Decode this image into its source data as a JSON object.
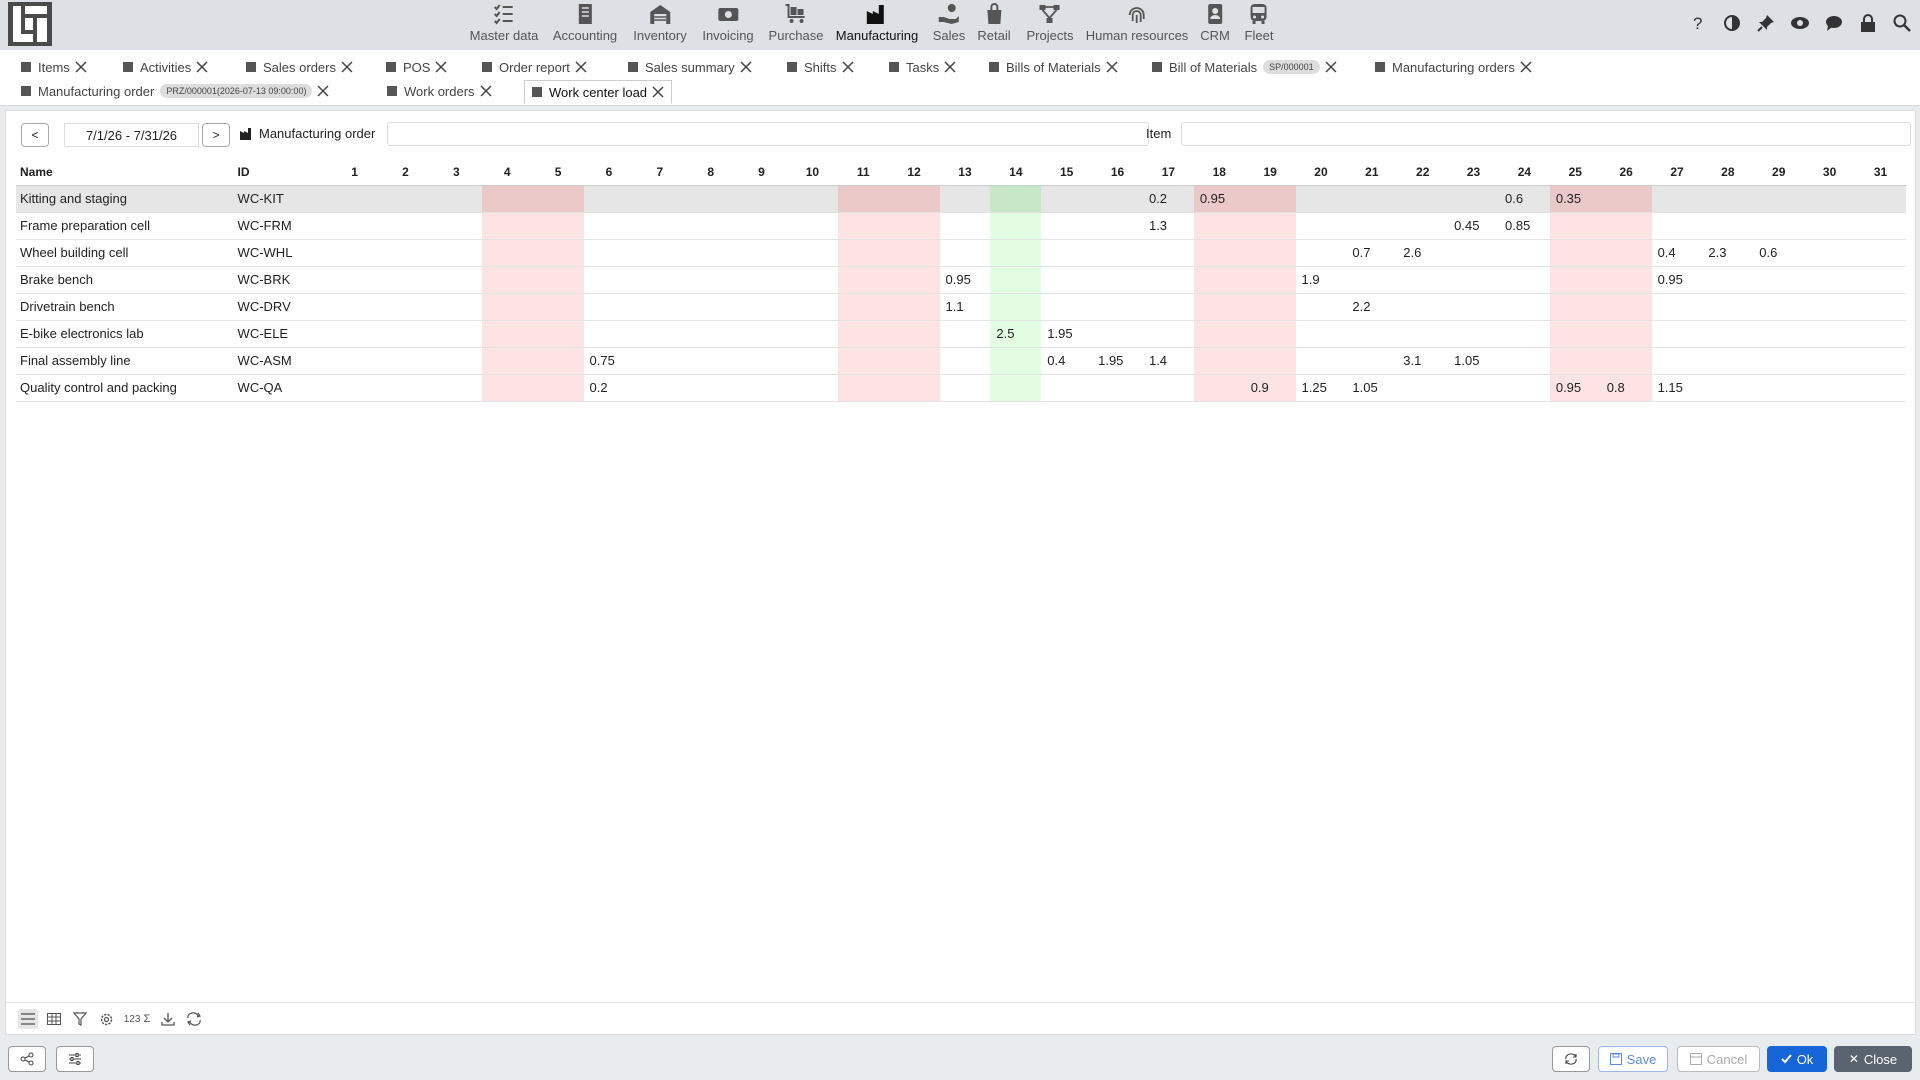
{
  "nav": {
    "items": [
      {
        "label": "Master data",
        "icon": "checklist-icon"
      },
      {
        "label": "Accounting",
        "icon": "ledger-icon"
      },
      {
        "label": "Inventory",
        "icon": "warehouse-icon"
      },
      {
        "label": "Invoicing",
        "icon": "cash-icon"
      },
      {
        "label": "Purchase",
        "icon": "cart-icon"
      },
      {
        "label": "Manufacturing",
        "icon": "factory-icon"
      },
      {
        "label": "Sales",
        "icon": "hand-coin-icon"
      },
      {
        "label": "Retail",
        "icon": "bag-icon"
      },
      {
        "label": "Projects",
        "icon": "hierarchy-icon"
      },
      {
        "label": "Human resources",
        "icon": "fingerprint-icon"
      },
      {
        "label": "CRM",
        "icon": "contact-icon"
      },
      {
        "label": "Fleet",
        "icon": "bus-icon"
      }
    ],
    "active": "Manufacturing"
  },
  "tabs": {
    "row1": [
      {
        "label": "Items"
      },
      {
        "label": "Activities"
      },
      {
        "label": "Sales orders"
      },
      {
        "label": "POS"
      },
      {
        "label": "Order report"
      },
      {
        "label": "Sales summary"
      },
      {
        "label": "Shifts"
      },
      {
        "label": "Tasks"
      },
      {
        "label": "Bills of Materials"
      },
      {
        "label": "Bill of Materials",
        "badge": "SP/000001"
      },
      {
        "label": "Manufacturing orders"
      }
    ],
    "row2": [
      {
        "label": "Manufacturing order",
        "badge": "PRZ/000001(2026-07-13 09:00:00)"
      },
      {
        "label": "Work orders"
      },
      {
        "label": "Work center load"
      }
    ]
  },
  "filters": {
    "prev": "<",
    "next": ">",
    "date_range": "7/1/26 - 7/31/26",
    "mo_label": "Manufacturing order",
    "item_label": "Item"
  },
  "grid": {
    "headers": {
      "name": "Name",
      "id": "ID"
    },
    "days": [
      "1",
      "2",
      "3",
      "4",
      "5",
      "6",
      "7",
      "8",
      "9",
      "10",
      "11",
      "12",
      "13",
      "14",
      "15",
      "16",
      "17",
      "18",
      "19",
      "20",
      "21",
      "22",
      "23",
      "24",
      "25",
      "26",
      "27",
      "28",
      "29",
      "30",
      "31"
    ],
    "weekend_days": [
      4,
      5,
      11,
      12,
      18,
      19,
      25,
      26
    ],
    "today": 14,
    "rows": [
      {
        "name": "Kitting and staging",
        "id": "WC-KIT",
        "values": {
          "17": "0.2",
          "18": "0.95",
          "24": "0.6",
          "25": "0.35"
        }
      },
      {
        "name": "Frame preparation cell",
        "id": "WC-FRM",
        "values": {
          "17": "1.3",
          "23": "0.45",
          "24": "0.85"
        }
      },
      {
        "name": "Wheel building cell",
        "id": "WC-WHL",
        "values": {
          "21": "0.7",
          "22": "2.6",
          "27": "0.4",
          "28": "2.3",
          "29": "0.6"
        }
      },
      {
        "name": "Brake bench",
        "id": "WC-BRK",
        "values": {
          "13": "0.95",
          "20": "1.9",
          "27": "0.95"
        }
      },
      {
        "name": "Drivetrain bench",
        "id": "WC-DRV",
        "values": {
          "13": "1.1",
          "21": "2.2"
        }
      },
      {
        "name": "E-bike electronics lab",
        "id": "WC-ELE",
        "values": {
          "14": "2.5",
          "15": "1.95"
        }
      },
      {
        "name": "Final assembly line",
        "id": "WC-ASM",
        "values": {
          "6": "0.75",
          "15": "0.4",
          "16": "1.95",
          "17": "1.4",
          "22": "3.1",
          "23": "1.05"
        }
      },
      {
        "name": "Quality control and packing",
        "id": "WC-QA",
        "values": {
          "6": "0.2",
          "19": "0.9",
          "20": "1.25",
          "21": "1.05",
          "25": "0.95",
          "26": "0.8",
          "27": "1.15"
        }
      }
    ]
  },
  "footer_tools": {
    "numbers": "123"
  },
  "buttons": {
    "save": "Save",
    "cancel": "Cancel",
    "ok": "Ok",
    "close": "Close"
  }
}
